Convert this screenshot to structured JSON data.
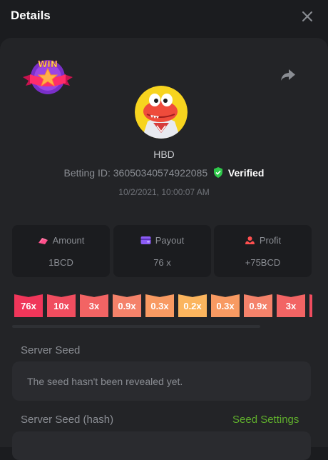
{
  "header": {
    "title": "Details",
    "close_icon": "close-icon"
  },
  "bet": {
    "username": "HBD",
    "betting_id_label": "Betting ID:",
    "betting_id": "36050340574922085",
    "verified_label": "Verified",
    "timestamp": "10/2/2021, 10:00:07 AM",
    "result_badge": "WIN"
  },
  "stats": [
    {
      "label": "Amount",
      "value": "1BCD",
      "icon": "coins-icon",
      "icon_color": "#ff4f8b"
    },
    {
      "label": "Payout",
      "value": "76 x",
      "icon": "wallet-icon",
      "icon_color": "#8c5cf6"
    },
    {
      "label": "Profit",
      "value": "+75BCD",
      "icon": "profit-icon",
      "icon_color": "#ff4f4f"
    }
  ],
  "history": [
    {
      "label": "76x",
      "color": "#f0365a"
    },
    {
      "label": "10x",
      "color": "#f04d5f"
    },
    {
      "label": "3x",
      "color": "#f26464"
    },
    {
      "label": "0.9x",
      "color": "#f4826a"
    },
    {
      "label": "0.3x",
      "color": "#f89a62"
    },
    {
      "label": "0.2x",
      "color": "#fbb55e"
    },
    {
      "label": "0.3x",
      "color": "#f89a62"
    },
    {
      "label": "0.9x",
      "color": "#f4826a"
    },
    {
      "label": "3x",
      "color": "#f26464"
    },
    {
      "label": "",
      "color": "#f04d5f"
    }
  ],
  "server_seed": {
    "label": "Server Seed",
    "value": "The seed hasn't been revealed yet."
  },
  "server_seed_hash": {
    "label": "Server Seed (hash)",
    "settings_link": "Seed Settings"
  },
  "colors": {
    "background": "#1b1c1f",
    "panel": "#232427",
    "accent_green": "#5fae2c",
    "verified_green": "#2fc84a"
  }
}
